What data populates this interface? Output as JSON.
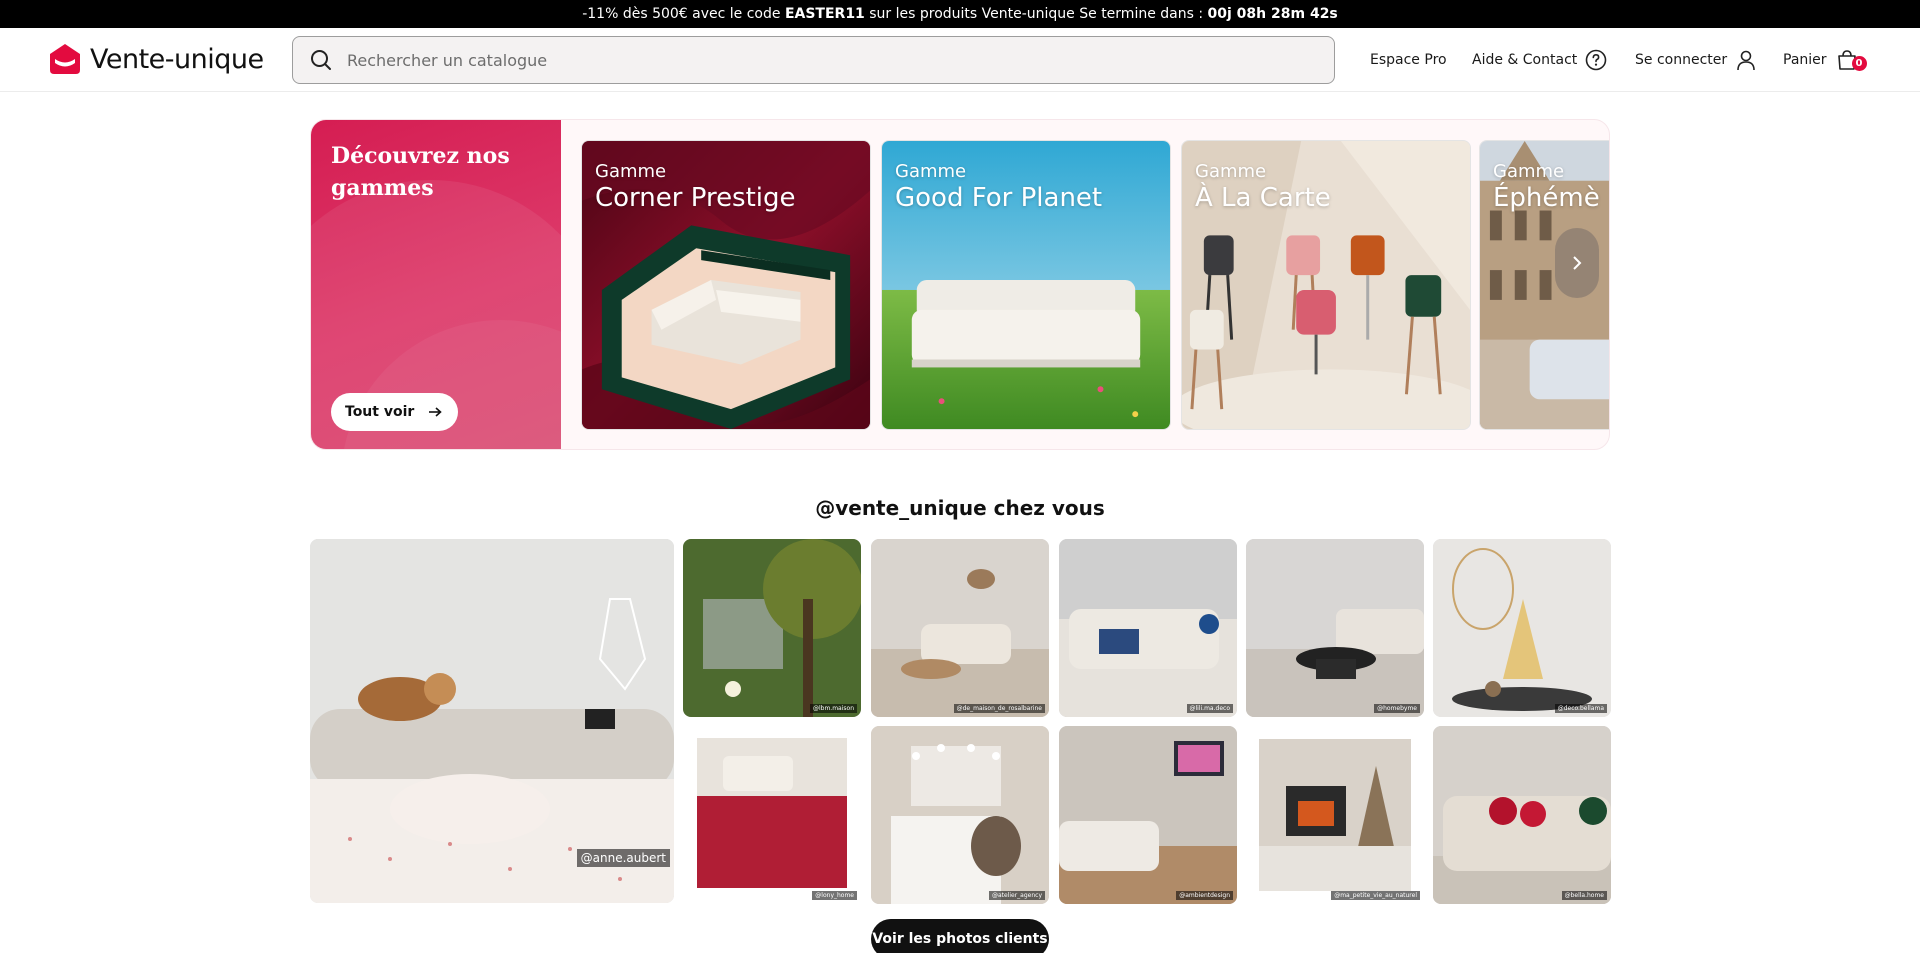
{
  "promo": {
    "text_before": "-11% dès 500€ avec le code ",
    "code": "EASTER11",
    "text_middle": " sur les produits Vente-unique Se termine dans : ",
    "countdown": "00j 08h 28m 42s"
  },
  "header": {
    "logo": "Vente-unique",
    "search_placeholder": "Rechercher un catalogue",
    "nav": {
      "pro": "Espace Pro",
      "help": "Aide & Contact",
      "login": "Se connecter",
      "cart": "Panier",
      "cart_count": "0"
    }
  },
  "ranges": {
    "title": "Découvrez nos gammes",
    "see_all": "Tout voir",
    "cards": [
      {
        "prefix": "Gamme",
        "name": "Corner Prestige"
      },
      {
        "prefix": "Gamme",
        "name": "Good For Planet"
      },
      {
        "prefix": "Gamme",
        "name": "À La Carte"
      },
      {
        "prefix": "Gamme",
        "name": "Éphémè"
      }
    ]
  },
  "instagram": {
    "title": "@vente_unique chez vous",
    "photos": [
      {
        "handle": "@anne.aubert"
      },
      {
        "handle": "@lbm.maison"
      },
      {
        "handle": "@de_maison_de_rosalbarine"
      },
      {
        "handle": "@lili.ma.deco"
      },
      {
        "handle": "@homebyme"
      },
      {
        "handle": "@deco.bellama"
      },
      {
        "handle": "@lony_home"
      },
      {
        "handle": "@atelier_agency"
      },
      {
        "handle": "@ambientdesign"
      },
      {
        "handle": "@ma_petite_vie_au_naturel"
      },
      {
        "handle": "@bella.home"
      }
    ],
    "cta": "Voir les photos clients"
  },
  "colors": {
    "brand": "#e30b3f",
    "promo_bg": "#000000",
    "banner_pink": "#d51d52"
  }
}
